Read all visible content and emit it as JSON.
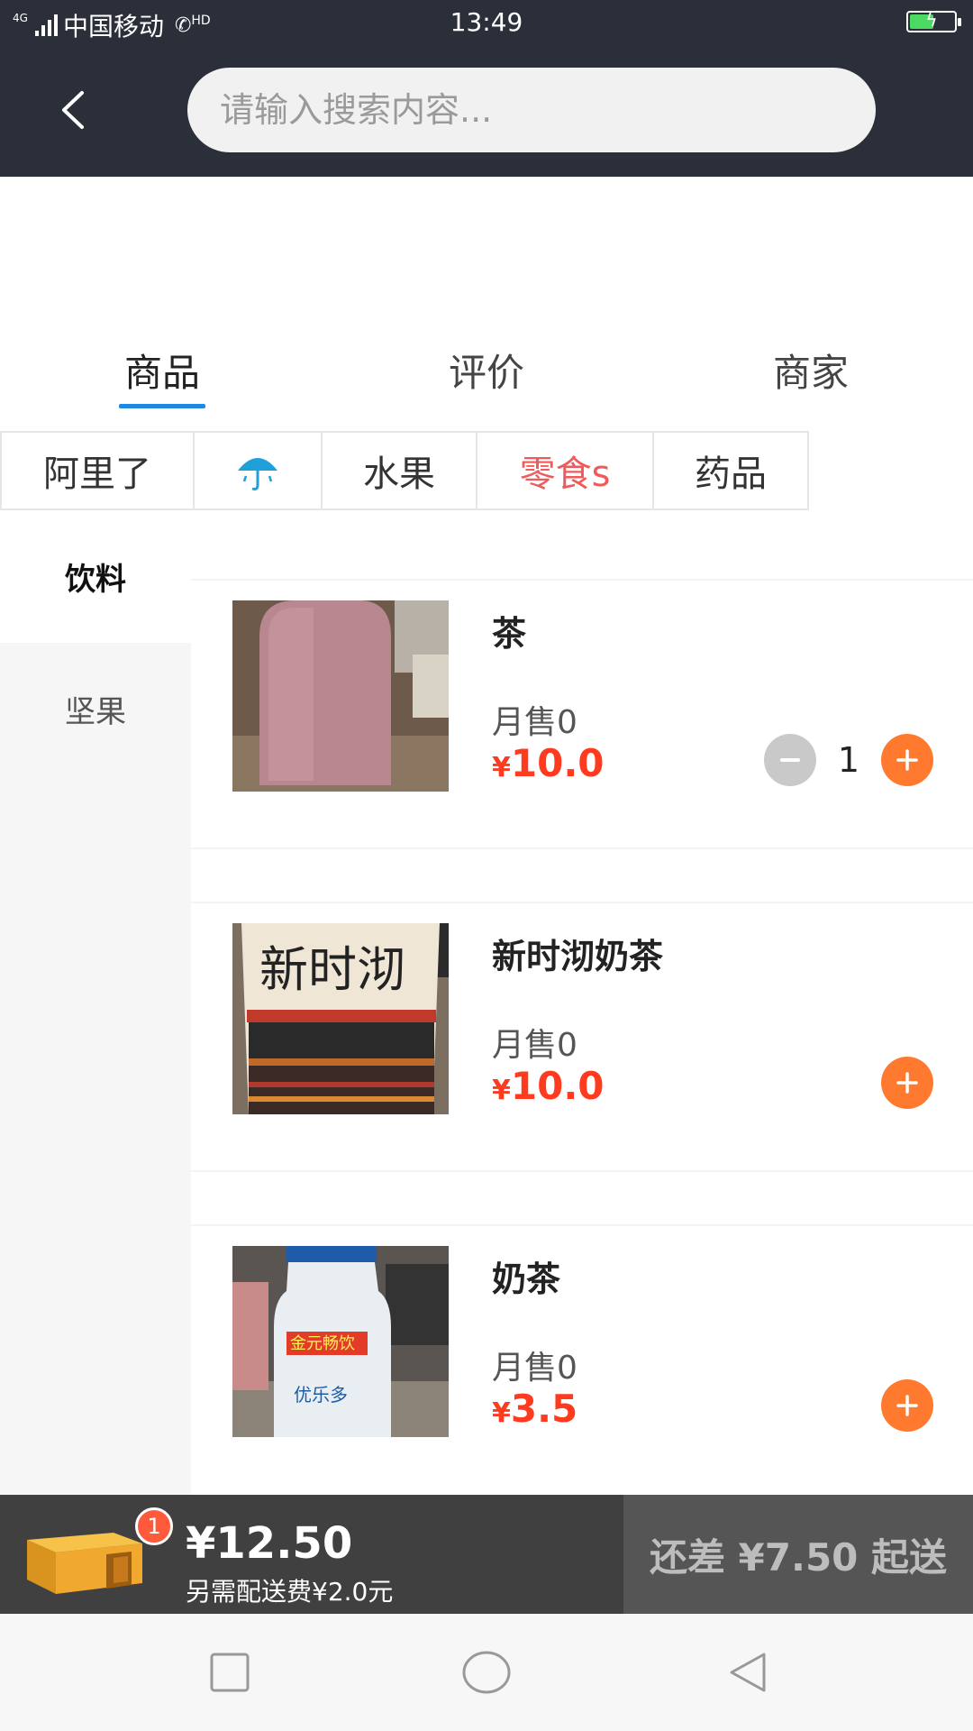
{
  "status_bar": {
    "network": "4G",
    "carrier": "中国移动",
    "call_tag": "HD",
    "time": "13:49",
    "battery_level": 0.55,
    "battery_color": "#4cd964"
  },
  "header": {
    "back_icon": "back-chevron-icon",
    "search_placeholder": "请输入搜索内容..."
  },
  "tabs": [
    {
      "label": "商品",
      "active": true
    },
    {
      "label": "评价",
      "active": false
    },
    {
      "label": "商家",
      "active": false
    }
  ],
  "category_chips": [
    {
      "label": "阿里了",
      "active": false
    },
    {
      "label": "",
      "icon": "umbrella-icon",
      "active": false
    },
    {
      "label": "水果",
      "active": false
    },
    {
      "label": "零食s",
      "active": true
    },
    {
      "label": "药品",
      "active": false
    }
  ],
  "sidebar": {
    "items": [
      {
        "label": "饮料",
        "active": true
      },
      {
        "label": "坚果",
        "active": false
      }
    ]
  },
  "products": [
    {
      "name": "茶",
      "sales": "月售0",
      "currency": "¥",
      "price": "10.0",
      "quantity": "1",
      "image_icon": "pink-bottle-photo"
    },
    {
      "name": "新时沏奶茶",
      "sales": "月售0",
      "currency": "¥",
      "price": "10.0",
      "quantity": "",
      "image_icon": "milk-tea-cup-photo"
    },
    {
      "name": "奶茶",
      "sales": "月售0",
      "currency": "¥",
      "price": "3.5",
      "quantity": "",
      "image_icon": "yogurt-drink-bottle-photo"
    }
  ],
  "cart": {
    "badge_count": "1",
    "total": "¥12.50",
    "delivery_fee_note": "另需配送费¥2.0元",
    "checkout_status": "还差 ¥7.50 起送"
  },
  "colors": {
    "topbar": "#2b2f39",
    "accent_blue": "#1e88e5",
    "price_red": "#ff3b1f",
    "plus_orange": "#ff7a2f",
    "active_chip": "#f05a5a"
  },
  "nav": {
    "recent_icon": "square-recent-apps-icon",
    "home_icon": "circle-home-icon",
    "back_icon": "triangle-back-icon"
  }
}
